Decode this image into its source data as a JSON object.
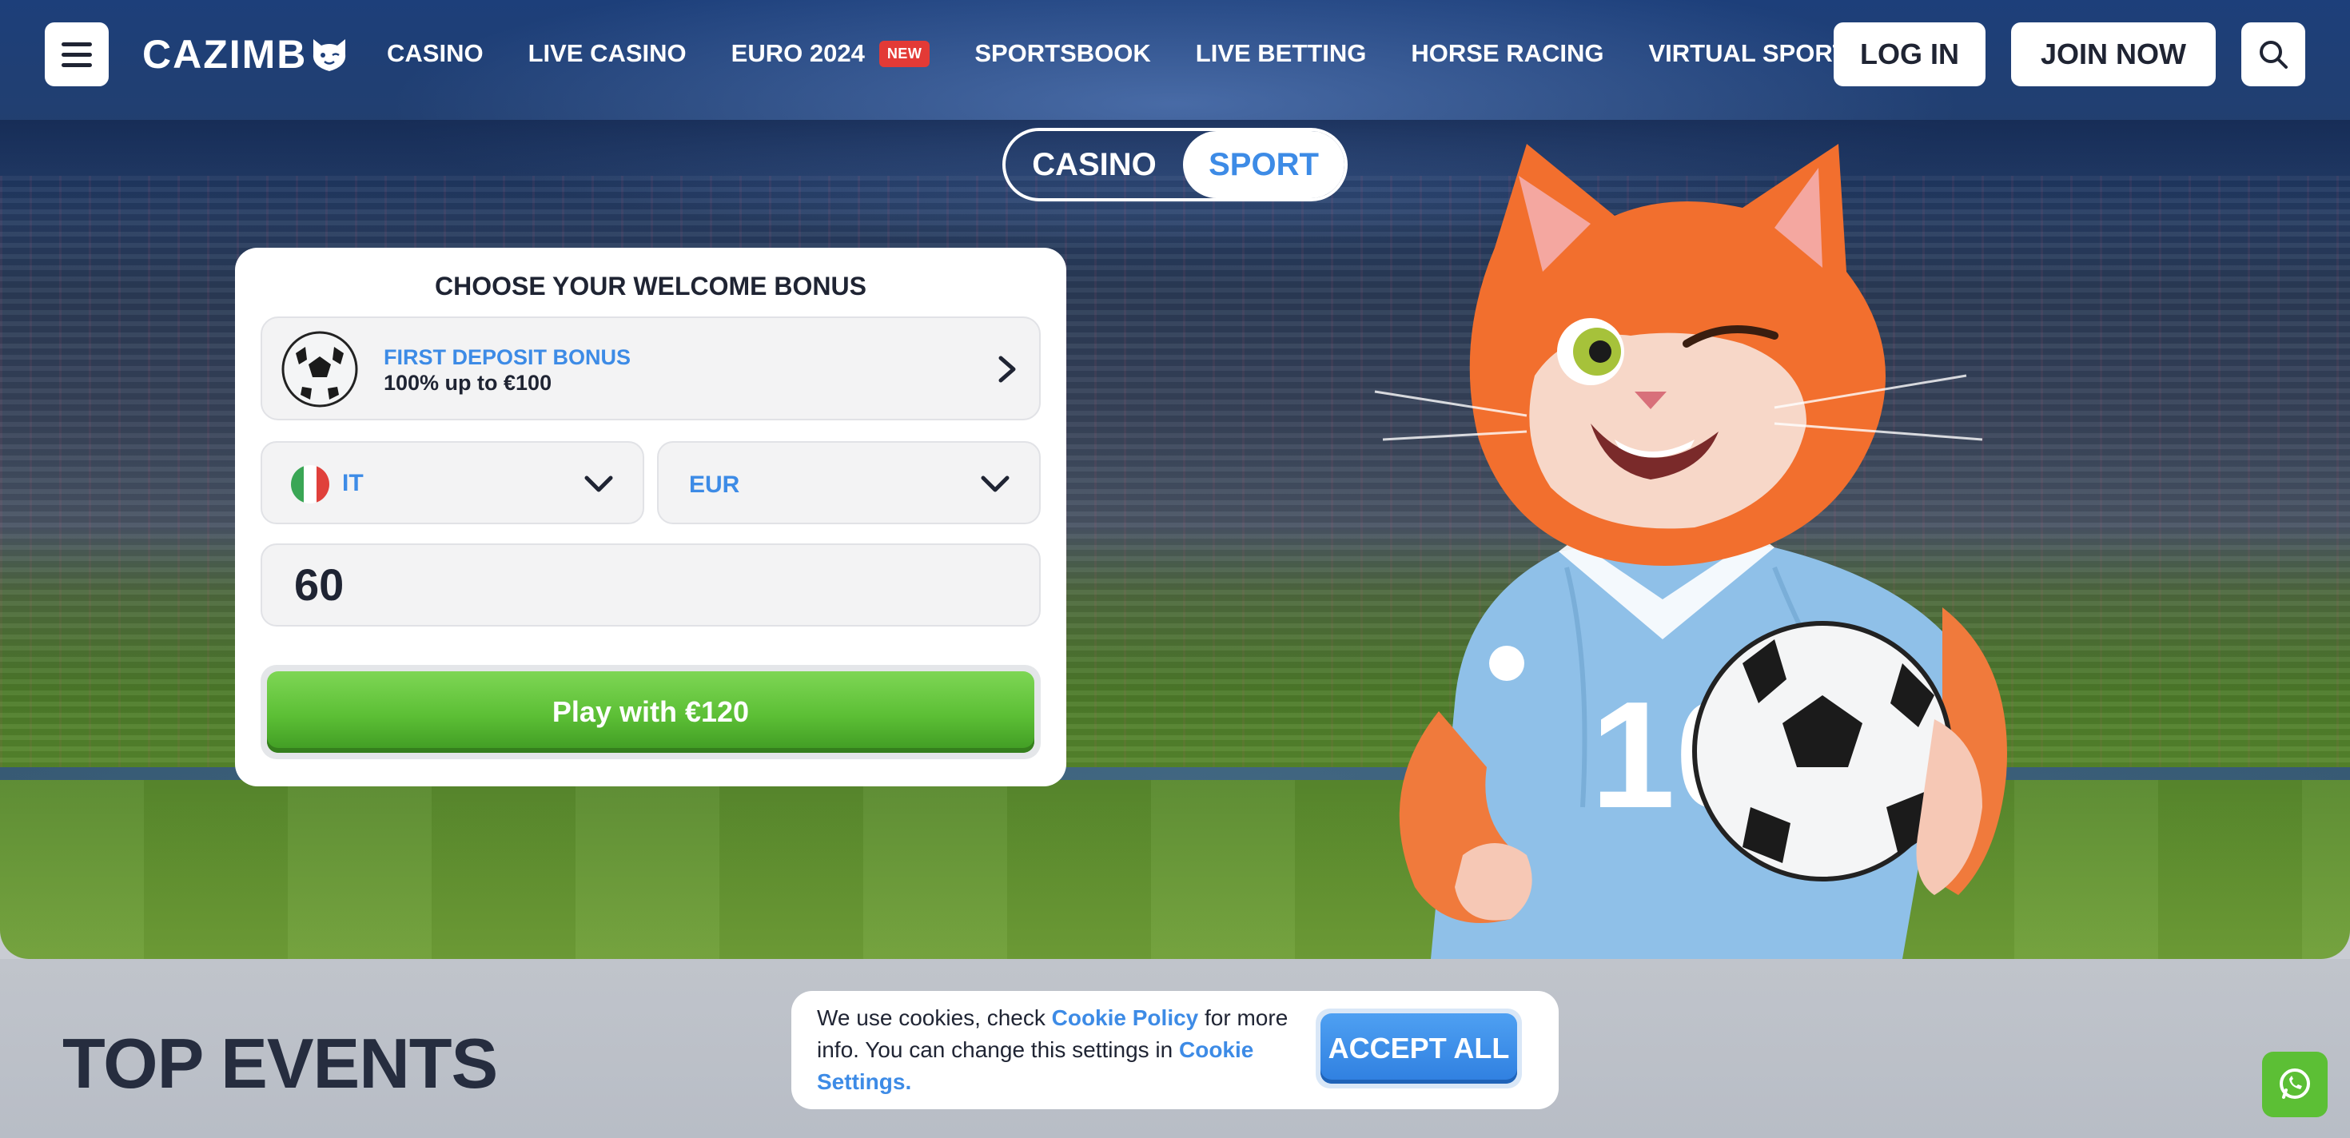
{
  "brand": {
    "logo_text": "CAZIMB",
    "logo_icon": "cat-head-icon"
  },
  "nav": {
    "items": [
      {
        "label": "CASINO"
      },
      {
        "label": "LIVE CASINO"
      },
      {
        "label": "EURO 2024",
        "badge": "NEW"
      },
      {
        "label": "SPORTSBOOK"
      },
      {
        "label": "LIVE BETTING"
      },
      {
        "label": "HORSE RACING"
      },
      {
        "label": "VIRTUAL SPORTS"
      }
    ],
    "login_label": "LOG IN",
    "join_label": "JOIN NOW"
  },
  "mode_switch": {
    "casino_label": "CASINO",
    "sport_label": "SPORT",
    "active": "SPORT"
  },
  "bonus_card": {
    "title": "CHOOSE YOUR WELCOME BONUS",
    "bonus_name": "FIRST DEPOSIT BONUS",
    "bonus_desc": "100% up to €100",
    "country": "IT",
    "currency": "EUR",
    "amount": "60",
    "play_label": "Play with €120"
  },
  "hero_image": {
    "player_number": "10"
  },
  "top_events_title": "TOP EVENTS",
  "cookie": {
    "text_1": "We use cookies, check ",
    "link_policy": "Cookie Policy",
    "text_2": " for more info. You can change this settings in ",
    "link_settings": "Cookie Settings.",
    "accept_label": "ACCEPT ALL"
  },
  "colors": {
    "accent_blue": "#3d8be6",
    "play_green": "#5cbf35",
    "badge_red": "#e33a36",
    "text_dark": "#1f2433"
  }
}
